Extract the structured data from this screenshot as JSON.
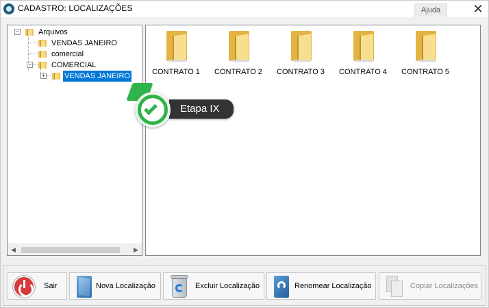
{
  "window": {
    "title": "CADASTRO: LOCALIZAÇÕES",
    "help_tab": "Ajuda",
    "close_glyph": "✕"
  },
  "tree": {
    "root": "Arquivos",
    "items": [
      {
        "label": "VENDAS JANEIRO"
      },
      {
        "label": "comercial"
      },
      {
        "label": "COMERCIAL"
      },
      {
        "label": "VENDAS JANEIRO",
        "selected": true
      }
    ],
    "expander_minus": "−",
    "expander_plus": "+",
    "scroll_left": "◀",
    "scroll_right": "▶"
  },
  "files": [
    {
      "label": "CONTRATO 1"
    },
    {
      "label": "CONTRATO 2"
    },
    {
      "label": "CONTRATO 3"
    },
    {
      "label": "CONTRATO 4"
    },
    {
      "label": "CONTRATO 5"
    }
  ],
  "tooltip": {
    "text": "Etapa IX",
    "icon": "check-icon",
    "color": "#2fb34a"
  },
  "toolbar": {
    "exit_label": "Sair",
    "new_label": "Nova Localização",
    "delete_label": "Excluir Localização",
    "rename_label": "Renomear Localização",
    "copy_label": "Copiar Localizações"
  },
  "colors": {
    "selection": "#0078d7",
    "exit_icon": "#d63a3a"
  }
}
